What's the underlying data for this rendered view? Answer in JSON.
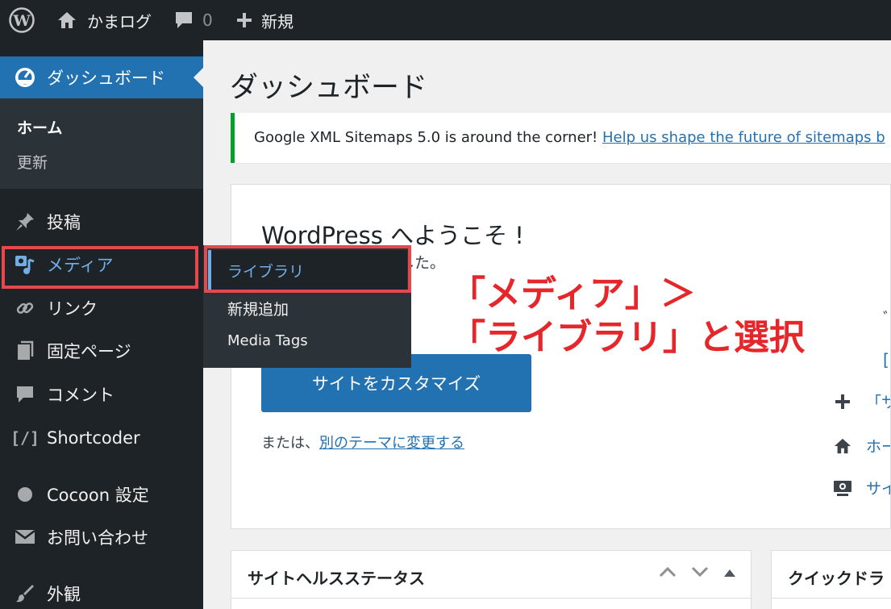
{
  "admin_bar": {
    "site_name": "かまログ",
    "comment_count": "0",
    "new_label": "新規",
    "icons": [
      "wordpress-logo-icon",
      "home-icon",
      "comment-icon",
      "plus-icon"
    ]
  },
  "sidebar": {
    "dashboard_label": "ダッシュボード",
    "submenu": {
      "home": "ホーム",
      "update": "更新"
    },
    "items": [
      {
        "label": "投稿",
        "icon": "pin-icon"
      },
      {
        "label": "メディア",
        "icon": "media-icon"
      },
      {
        "label": "リンク",
        "icon": "link-icon"
      },
      {
        "label": "固定ページ",
        "icon": "page-icon"
      },
      {
        "label": "コメント",
        "icon": "comment-icon"
      },
      {
        "label": "Shortcoder",
        "icon": "shortcode-icon"
      },
      {
        "label": "Cocoon 設定",
        "icon": "circle-icon"
      },
      {
        "label": "お問い合わせ",
        "icon": "mail-icon"
      },
      {
        "label": "外観",
        "icon": "brush-icon"
      }
    ],
    "accent_color": "#2271b1"
  },
  "flyout": {
    "library": "ライブラリ",
    "add_new": "新規追加",
    "media_tags": "Media Tags"
  },
  "main": {
    "page_title": "ダッシュボード",
    "notice": {
      "text": "Google XML Sitemaps 5.0 is around the corner!",
      "link": "Help us shape the future of sitemaps b"
    },
    "welcome": {
      "title": "WordPress へようこそ !",
      "subtitle_fragment": "利なリンクを集めました。",
      "customize_button": "サイトをカスタマイズ",
      "alt_prefix": "または、",
      "alt_link": "別のテーマに変更する",
      "col3_fragment_1": "ﾞ",
      "col3_fragment_2": "[",
      "next_steps": [
        "「サ",
        "ホー",
        "サイ"
      ]
    },
    "postboxes": {
      "health_title": "サイトヘルスステータス",
      "quick_title": "クイックドラ"
    }
  },
  "annotation": {
    "line1": "「メディア」＞",
    "line2": "「ライブラリ」と選択",
    "color": "#e5262a"
  }
}
